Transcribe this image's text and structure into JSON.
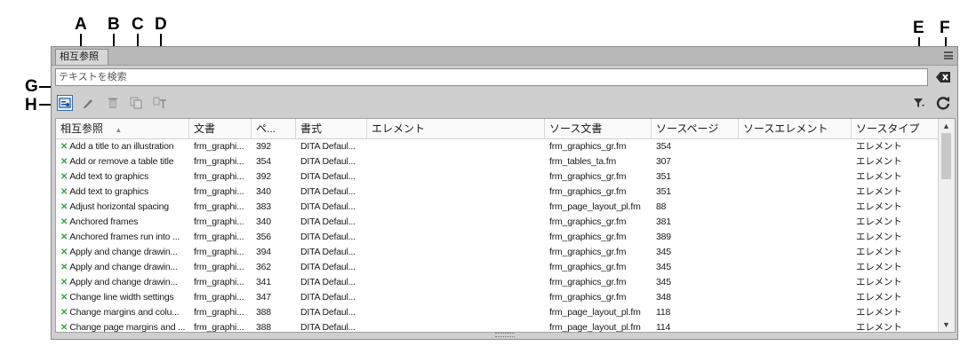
{
  "callouts": {
    "a": "A",
    "b": "B",
    "c": "C",
    "d": "D",
    "e": "E",
    "f": "F",
    "g": "G",
    "h": "H"
  },
  "panel": {
    "tab_label": "相互参照",
    "search_placeholder": "テキストを検索"
  },
  "toolbar": {
    "icons": [
      "add-crossref-icon",
      "edit-pencil-icon",
      "delete-icon",
      "copy-icon",
      "insert-text-icon",
      "filter-icon",
      "refresh-icon"
    ]
  },
  "table": {
    "headers": [
      "相互参照",
      "文書",
      "ペ...",
      "書式",
      "エレメント",
      "ソース文書",
      "ソースページ",
      "ソースエレメント",
      "ソースタイプ"
    ],
    "sort_indicator": "▲",
    "rows": [
      [
        "Add a title to an illustration",
        "frm_graphi...",
        "392",
        "DITA Defaul...",
        "",
        "frm_graphics_gr.fm",
        "354",
        "",
        "エレメント"
      ],
      [
        "Add or remove a table title",
        "frm_graphi...",
        "354",
        "DITA Defaul...",
        "",
        "frm_tables_ta.fm",
        "307",
        "",
        "エレメント"
      ],
      [
        "Add text to graphics",
        "frm_graphi...",
        "392",
        "DITA Defaul...",
        "",
        "frm_graphics_gr.fm",
        "351",
        "",
        "エレメント"
      ],
      [
        "Add text to graphics",
        "frm_graphi...",
        "340",
        "DITA Defaul...",
        "",
        "frm_graphics_gr.fm",
        "351",
        "",
        "エレメント"
      ],
      [
        "Adjust horizontal spacing",
        "frm_graphi...",
        "383",
        "DITA Defaul...",
        "",
        "frm_page_layout_pl.fm",
        "88",
        "",
        "エレメント"
      ],
      [
        "Anchored frames",
        "frm_graphi...",
        "340",
        "DITA Defaul...",
        "",
        "frm_graphics_gr.fm",
        "381",
        "",
        "エレメント"
      ],
      [
        "Anchored frames run into ...",
        "frm_graphi...",
        "356",
        "DITA Defaul...",
        "",
        "frm_graphics_gr.fm",
        "389",
        "",
        "エレメント"
      ],
      [
        "Apply and change drawin...",
        "frm_graphi...",
        "394",
        "DITA Defaul...",
        "",
        "frm_graphics_gr.fm",
        "345",
        "",
        "エレメント"
      ],
      [
        "Apply and change drawin...",
        "frm_graphi...",
        "362",
        "DITA Defaul...",
        "",
        "frm_graphics_gr.fm",
        "345",
        "",
        "エレメント"
      ],
      [
        "Apply and change drawin...",
        "frm_graphi...",
        "341",
        "DITA Defaul...",
        "",
        "frm_graphics_gr.fm",
        "345",
        "",
        "エレメント"
      ],
      [
        "Change line width settings",
        "frm_graphi...",
        "347",
        "DITA Defaul...",
        "",
        "frm_graphics_gr.fm",
        "348",
        "",
        "エレメント"
      ],
      [
        "Change margins and colu...",
        "frm_graphi...",
        "388",
        "DITA Defaul...",
        "",
        "frm_page_layout_pl.fm",
        "118",
        "",
        "エレメント"
      ],
      [
        "Change page margins and ...",
        "frm_graphi...",
        "388",
        "DITA Defaul...",
        "",
        "frm_page_layout_pl.fm",
        "114",
        "",
        "エレメント"
      ]
    ]
  }
}
